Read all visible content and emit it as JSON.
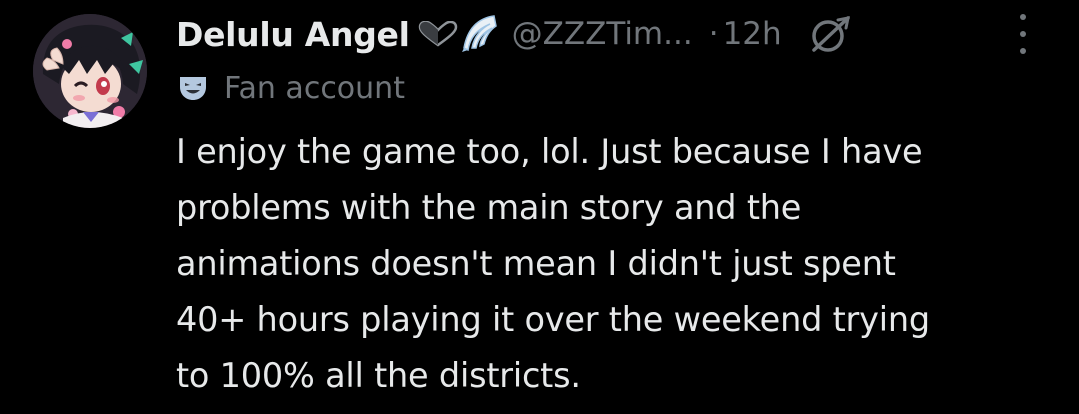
{
  "author": {
    "display_name": "Delulu Angel",
    "handle": "@ZZZTim...",
    "name_badges": [
      "heart-icon",
      "wing-icon"
    ],
    "avatar": "avatar-image"
  },
  "meta": {
    "separator": "·",
    "time": "12h",
    "grok_icon": "grok-icon",
    "more_icon": "more-options-icon"
  },
  "label": {
    "icon": "theater-mask-icon",
    "text": "Fan account"
  },
  "body": {
    "text": "I enjoy the game too, lol. Just because I have\nproblems with the main story and the\nanimations doesn't mean I didn't just spent\n40+ hours playing it over the weekend trying\nto 100% all the districts."
  },
  "colors": {
    "background": "#000000",
    "primary_text": "#e7e9ea",
    "secondary_text": "#71767b"
  }
}
